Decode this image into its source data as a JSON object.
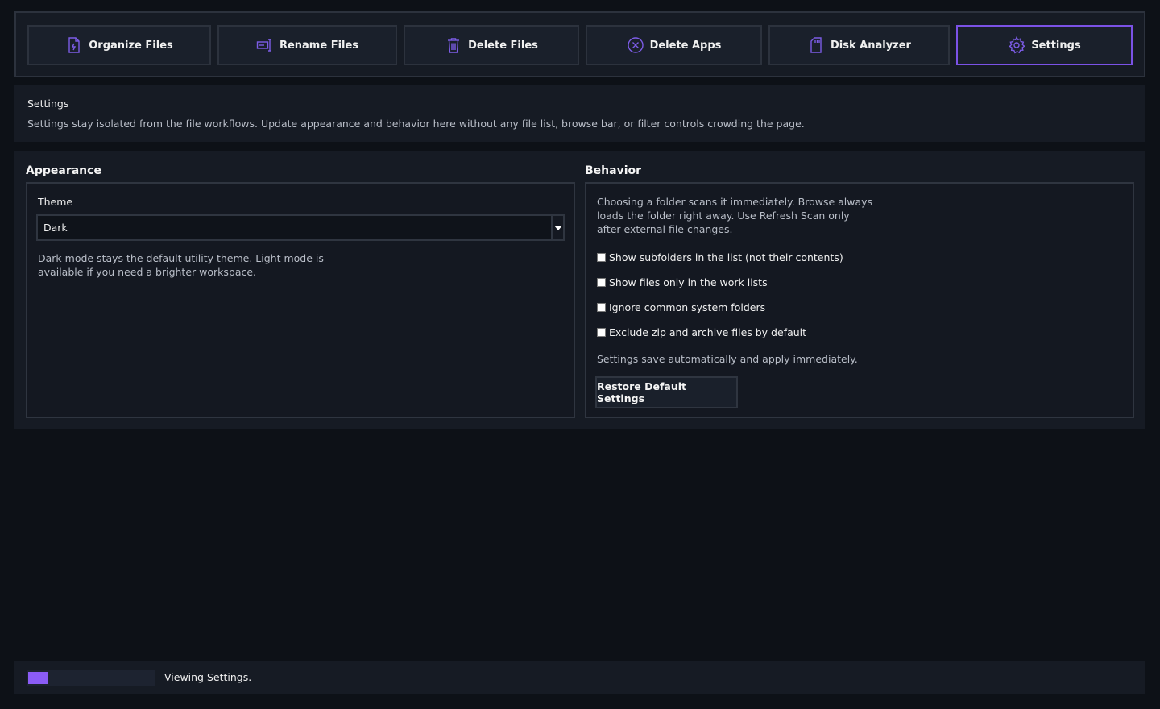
{
  "tabs": [
    {
      "label": "Organize Files",
      "icon": "organize-file-icon"
    },
    {
      "label": "Rename Files",
      "icon": "rename-icon"
    },
    {
      "label": "Delete Files",
      "icon": "trash-icon"
    },
    {
      "label": "Delete Apps",
      "icon": "circle-x-icon"
    },
    {
      "label": "Disk Analyzer",
      "icon": "sd-card-icon"
    },
    {
      "label": "Settings",
      "icon": "gear-icon",
      "active": true
    }
  ],
  "info": {
    "title": "Settings",
    "description": "Settings stay isolated from the file workflows. Update appearance and behavior here without any file list, browse bar, or filter controls crowding the page."
  },
  "appearance": {
    "title": "Appearance",
    "theme_label": "Theme",
    "theme_value": "Dark",
    "help": "Dark mode stays the default utility theme. Light mode is available if you need a brighter workspace."
  },
  "behavior": {
    "title": "Behavior",
    "description": "Choosing a folder scans it immediately. Browse always loads the folder right away. Use Refresh Scan only after external file changes.",
    "options": [
      {
        "label": "Show subfolders in the list (not their contents)",
        "checked": false
      },
      {
        "label": "Show files only in the work lists",
        "checked": false
      },
      {
        "label": "Ignore common system folders",
        "checked": false
      },
      {
        "label": "Exclude zip and archive files by default",
        "checked": false
      }
    ],
    "autosave_note": "Settings save automatically and apply immediately.",
    "restore_label": "Restore Default Settings"
  },
  "status": {
    "text": "Viewing Settings.",
    "progress": 0.18
  },
  "colors": {
    "accent": "#8b5cf6",
    "active_border": "#7b52e6",
    "background": "#0d1117",
    "panel": "#161b24"
  }
}
